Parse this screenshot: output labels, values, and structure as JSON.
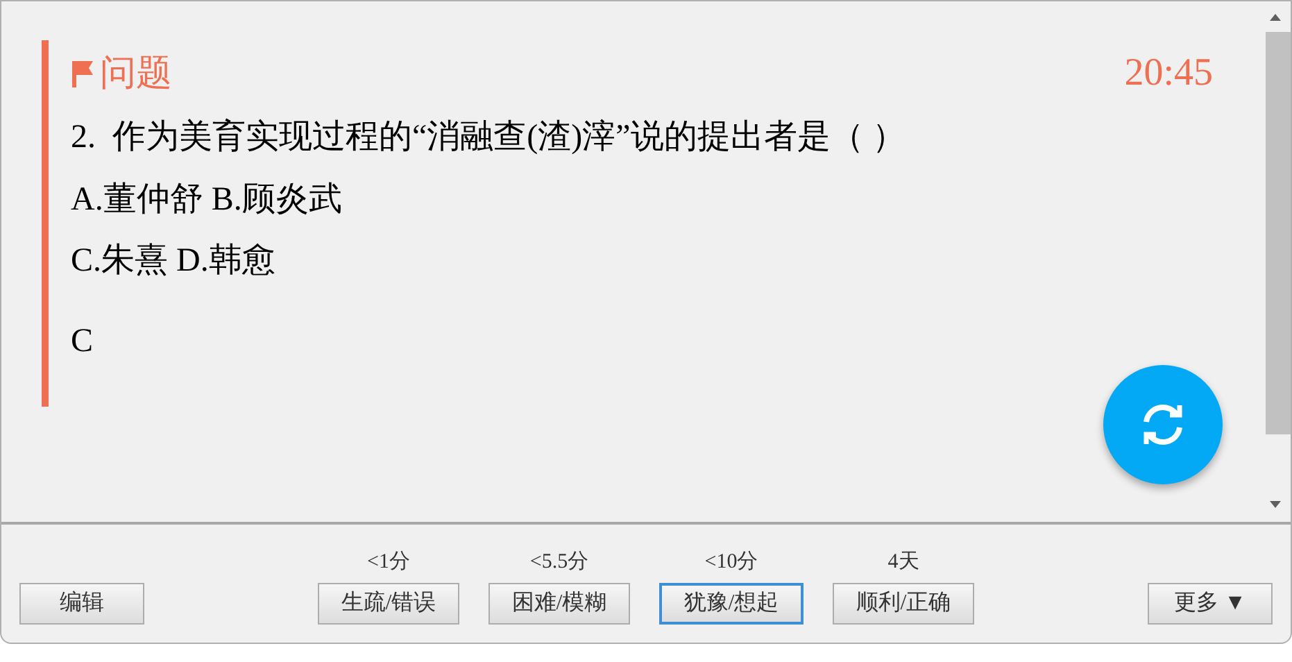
{
  "card": {
    "title": "问题",
    "timer": "20:45",
    "question": "2.  作为美育实现过程的“消融查(渣)滓”说的提出者是（ ）",
    "options": [
      "A.董仲舒 B.顾炎武",
      "C.朱熹 D.韩愈"
    ],
    "answer": "C"
  },
  "toolbar": {
    "edit": "编辑",
    "more": "更多 ▼",
    "grades": [
      {
        "interval": "<1分",
        "label": "生疏/错误",
        "selected": false
      },
      {
        "interval": "<5.5分",
        "label": "困难/模糊",
        "selected": false
      },
      {
        "interval": "<10分",
        "label": "犹豫/想起",
        "selected": true
      },
      {
        "interval": "4天",
        "label": "顺利/正确",
        "selected": false
      }
    ]
  }
}
